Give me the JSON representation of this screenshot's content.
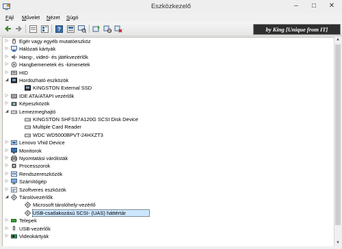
{
  "window": {
    "title": "Eszközkezelő",
    "min": "–",
    "max": "□",
    "close": "✕"
  },
  "menu": [
    {
      "label_u": "F",
      "label_rest": "ájl"
    },
    {
      "label_u": "M",
      "label_rest": "űvelet"
    },
    {
      "label_u": "N",
      "label_rest": "ézet"
    },
    {
      "label_u": "S",
      "label_rest": "úgó"
    }
  ],
  "watermark": "by King [Unique from IT]",
  "toolbar_icons": [
    "back-icon",
    "forward-icon",
    "properties-icon",
    "device-list-icon",
    "help-icon",
    "view-icon",
    "computer-scan-icon",
    "update-driver-icon",
    "disable-device-icon",
    "uninstall-icon"
  ],
  "tree": [
    {
      "label": "Egér vagy egyéb mutatóeszköz",
      "level": 1,
      "state": "collapsed",
      "icon": "mouse-icon"
    },
    {
      "label": "Hálózati kártyák",
      "level": 1,
      "state": "collapsed",
      "icon": "network-icon"
    },
    {
      "label": "Hang-, videó- és játékvezérlők",
      "level": 1,
      "state": "collapsed",
      "icon": "sound-icon"
    },
    {
      "label": "Hangbemenetek és -kimenetek",
      "level": 1,
      "state": "collapsed",
      "icon": "audio-io-icon"
    },
    {
      "label": "HID",
      "level": 1,
      "state": "collapsed",
      "icon": "hid-icon"
    },
    {
      "label": "Hordozható eszközök",
      "level": 1,
      "state": "expanded",
      "icon": "portable-device-icon"
    },
    {
      "label": "KINGSTON External SSD",
      "level": 2,
      "state": "leaf",
      "icon": "portable-device-icon"
    },
    {
      "label": "IDE ATA/ATAPI vezérlők",
      "level": 1,
      "state": "collapsed",
      "icon": "ide-icon"
    },
    {
      "label": "Képeszközök",
      "level": 1,
      "state": "collapsed",
      "icon": "camera-icon"
    },
    {
      "label": "Lemezmeghajtó",
      "level": 1,
      "state": "expanded",
      "icon": "disk-drive-icon"
    },
    {
      "label": "KINGSTON  SHFS37A120G SCSI Disk Device",
      "level": 2,
      "state": "leaf",
      "icon": "disk-drive-icon"
    },
    {
      "label": "Multiple Card Reader",
      "level": 2,
      "state": "leaf",
      "icon": "disk-drive-icon"
    },
    {
      "label": "WDC WD5000BPVT-24HXZT3",
      "level": 2,
      "state": "leaf",
      "icon": "disk-drive-icon"
    },
    {
      "label": "Lenovo Vhid Device",
      "level": 1,
      "state": "collapsed",
      "icon": "lenovo-device-icon"
    },
    {
      "label": "Monitorok",
      "level": 1,
      "state": "collapsed",
      "icon": "monitor-icon"
    },
    {
      "label": "Nyomtatási várólisták",
      "level": 1,
      "state": "collapsed",
      "icon": "printer-icon"
    },
    {
      "label": "Processzorok",
      "level": 1,
      "state": "collapsed",
      "icon": "processor-icon"
    },
    {
      "label": "Rendszereszközök",
      "level": 1,
      "state": "collapsed",
      "icon": "system-device-icon"
    },
    {
      "label": "Számítógép",
      "level": 1,
      "state": "collapsed",
      "icon": "computer-icon"
    },
    {
      "label": "Szoftveres eszközök",
      "level": 1,
      "state": "collapsed",
      "icon": "software-device-icon"
    },
    {
      "label": "Tárolóvezérlők",
      "level": 1,
      "state": "expanded",
      "icon": "storage-controller-icon"
    },
    {
      "label": "Microsoft tárolóhely-vezérlő",
      "level": 2,
      "state": "leaf",
      "icon": "storage-controller-icon"
    },
    {
      "label": "USB-csatlakozású SCSI- (UAS) háttértár",
      "level": 2,
      "state": "leaf",
      "selected": true,
      "icon": "storage-controller-icon"
    },
    {
      "label": "Telepek",
      "level": 1,
      "state": "collapsed",
      "icon": "battery-icon"
    },
    {
      "label": "USB-vezérlők",
      "level": 1,
      "state": "collapsed",
      "icon": "usb-icon"
    },
    {
      "label": "Videokártyák",
      "level": 1,
      "state": "collapsed",
      "icon": "display-adapter-icon"
    }
  ],
  "colors": {
    "selection": "#cce6ff",
    "icon_blue": "#3a6ea5",
    "icon_gray": "#7a7a7a"
  }
}
